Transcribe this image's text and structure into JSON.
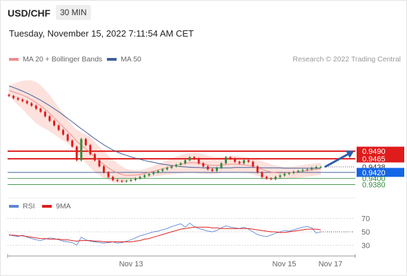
{
  "header": {
    "symbol": "USD/CHF",
    "timeframe": "30 MIN",
    "datetime": "Tuesday, November 15, 2022 7:11:54 AM CET",
    "credit": "Research © 2022 Trading Central"
  },
  "legend": {
    "ma20_label": "MA 20 + Bollinger Bands",
    "ma50_label": "MA 50",
    "rsi_label": "RSI",
    "ma9_label": "9MA"
  },
  "colors": {
    "bull": "#2e8b3a",
    "bear": "#e01b1b",
    "ma20": "#f08c8c",
    "band_fill": "#fde1dc",
    "ma50": "#3f5f9a",
    "resistance": "#e01b1b",
    "support": "#2e8b3a",
    "price_tag": "#1565e8",
    "rsi": "#5c86d6",
    "rsi_ma": "#e01b1b",
    "arrow": "#2e5fa8"
  },
  "chart_data": [
    {
      "type": "candlestick",
      "title": "USD/CHF 30 MIN",
      "x_ticks": [
        "Nov 13",
        "Nov 15",
        "Nov 17"
      ],
      "ylim": [
        0.934,
        0.972
      ],
      "price_levels": [
        {
          "value": "0.9490",
          "kind": "resistance"
        },
        {
          "value": "0.9465",
          "kind": "resistance"
        },
        {
          "value": "0.9438",
          "kind": "last_price"
        },
        {
          "value": "0.9420",
          "kind": "current"
        },
        {
          "value": "0.9400",
          "kind": "support"
        },
        {
          "value": "0.9380",
          "kind": "support"
        }
      ],
      "closes": [
        0.9672,
        0.9665,
        0.966,
        0.9655,
        0.9648,
        0.964,
        0.963,
        0.962,
        0.9605,
        0.959,
        0.9575,
        0.956,
        0.9545,
        0.9525,
        0.9505,
        0.946,
        0.953,
        0.951,
        0.948,
        0.946,
        0.944,
        0.942,
        0.9405,
        0.9395,
        0.9392,
        0.939,
        0.9392,
        0.9395,
        0.94,
        0.9405,
        0.941,
        0.9415,
        0.942,
        0.9425,
        0.943,
        0.9435,
        0.944,
        0.9445,
        0.945,
        0.946,
        0.947,
        0.9465,
        0.945,
        0.944,
        0.943,
        0.9425,
        0.9435,
        0.945,
        0.947,
        0.9465,
        0.9455,
        0.945,
        0.946,
        0.9455,
        0.944,
        0.942,
        0.9405,
        0.94,
        0.9398,
        0.9405,
        0.941,
        0.9415,
        0.9418,
        0.9422,
        0.9425,
        0.9428,
        0.943,
        0.9435,
        0.9438,
        0.9438
      ],
      "ma20": [
        0.969,
        0.9685,
        0.968,
        0.9675,
        0.9668,
        0.966,
        0.965,
        0.964,
        0.9628,
        0.9615,
        0.96,
        0.9585,
        0.957,
        0.9555,
        0.954,
        0.9522,
        0.951,
        0.9498,
        0.9485,
        0.947,
        0.9458,
        0.9446,
        0.9435,
        0.9425,
        0.9418,
        0.9413,
        0.941,
        0.941,
        0.9411,
        0.9413,
        0.9416,
        0.942,
        0.9424,
        0.9428,
        0.9432,
        0.9436,
        0.944,
        0.9444,
        0.9447,
        0.945,
        0.9452,
        0.9452,
        0.945,
        0.9448,
        0.9445,
        0.9443,
        0.9443,
        0.9444,
        0.9446,
        0.9447,
        0.9447,
        0.9446,
        0.9445,
        0.9443,
        0.944,
        0.9435,
        0.943,
        0.9425,
        0.9421,
        0.9419,
        0.9418,
        0.9418,
        0.9419,
        0.942,
        0.9422,
        0.9424,
        0.9426,
        0.9428,
        0.943,
        0.9432
      ],
      "bb_upper": [
        0.9705,
        0.9712,
        0.9718,
        0.9722,
        0.9724,
        0.9723,
        0.9718,
        0.9708,
        0.9692,
        0.9675,
        0.9655,
        0.9635,
        0.9615,
        0.9595,
        0.9575,
        0.956,
        0.9552,
        0.9545,
        0.9535,
        0.952,
        0.9505,
        0.949,
        0.9475,
        0.9462,
        0.945,
        0.944,
        0.9432,
        0.9428,
        0.9427,
        0.9428,
        0.9431,
        0.9436,
        0.9442,
        0.9448,
        0.9454,
        0.946,
        0.9466,
        0.9472,
        0.9477,
        0.9481,
        0.9484,
        0.9485,
        0.9484,
        0.948,
        0.9476,
        0.9472,
        0.947,
        0.947,
        0.9472,
        0.9474,
        0.9474,
        0.9473,
        0.9471,
        0.9469,
        0.9466,
        0.9462,
        0.9457,
        0.9452,
        0.9447,
        0.9443,
        0.944,
        0.9439,
        0.9439,
        0.944,
        0.9442,
        0.9444,
        0.9446,
        0.9448,
        0.945,
        0.9452
      ],
      "bb_lower": [
        0.9675,
        0.9658,
        0.9642,
        0.9628,
        0.9612,
        0.9597,
        0.9582,
        0.9572,
        0.9564,
        0.9555,
        0.9545,
        0.9535,
        0.9525,
        0.9515,
        0.9505,
        0.9484,
        0.9468,
        0.9451,
        0.9435,
        0.942,
        0.9411,
        0.9402,
        0.9395,
        0.9388,
        0.9386,
        0.9386,
        0.9388,
        0.9392,
        0.9395,
        0.9398,
        0.9401,
        0.9404,
        0.9406,
        0.9408,
        0.941,
        0.9412,
        0.9414,
        0.9416,
        0.9417,
        0.9419,
        0.942,
        0.9419,
        0.9416,
        0.9416,
        0.9414,
        0.9414,
        0.9416,
        0.9418,
        0.942,
        0.942,
        0.942,
        0.9419,
        0.9419,
        0.9417,
        0.9414,
        0.9408,
        0.9403,
        0.9398,
        0.9395,
        0.9395,
        0.9396,
        0.9397,
        0.9399,
        0.94,
        0.9402,
        0.9404,
        0.9406,
        0.9408,
        0.941,
        0.9412
      ],
      "ma50": [
        0.9705,
        0.97,
        0.9694,
        0.9688,
        0.9681,
        0.9674,
        0.9666,
        0.9658,
        0.9649,
        0.964,
        0.963,
        0.962,
        0.9609,
        0.9598,
        0.9587,
        0.9575,
        0.9564,
        0.9553,
        0.9542,
        0.9531,
        0.9521,
        0.9511,
        0.9502,
        0.9494,
        0.9487,
        0.9481,
        0.9476,
        0.9471,
        0.9467,
        0.9463,
        0.9459,
        0.9456,
        0.9453,
        0.945,
        0.9447,
        0.9445,
        0.9443,
        0.9441,
        0.9439,
        0.9438,
        0.9437,
        0.9436,
        0.9436,
        0.9435,
        0.9435,
        0.9435,
        0.9435,
        0.9435,
        0.9435,
        0.9435,
        0.9436,
        0.9436,
        0.9436,
        0.9436,
        0.9436,
        0.9436,
        0.9435,
        0.9435,
        0.9435,
        0.9435,
        0.9435,
        0.9434,
        0.9434,
        0.9434,
        0.9434,
        0.9434,
        0.9434,
        0.9434,
        0.9434,
        0.9434
      ],
      "forecast": {
        "from": 0.9438,
        "to": 0.949
      }
    },
    {
      "type": "line",
      "title": "RSI",
      "ylim": [
        20,
        80
      ],
      "y_ticks": [
        "70",
        "50",
        "30"
      ],
      "series": [
        {
          "name": "RSI",
          "values": [
            46,
            44,
            43,
            45,
            42,
            40,
            38,
            37,
            39,
            41,
            40,
            38,
            36,
            35,
            34,
            30,
            42,
            38,
            36,
            35,
            34,
            33,
            34,
            35,
            33,
            34,
            36,
            38,
            41,
            44,
            46,
            48,
            50,
            51,
            53,
            55,
            58,
            60,
            62,
            57,
            63,
            58,
            55,
            53,
            51,
            50,
            52,
            56,
            59,
            57,
            56,
            55,
            57,
            54,
            50,
            46,
            44,
            43,
            45,
            48,
            50,
            52,
            51,
            53,
            55,
            57,
            58,
            56,
            48,
            50
          ]
        },
        {
          "name": "9MA",
          "values": [
            45,
            45,
            44,
            44,
            43,
            42,
            41,
            40,
            40,
            39,
            39,
            39,
            38,
            38,
            37,
            36,
            37,
            37,
            37,
            36,
            36,
            35,
            35,
            35,
            35,
            35,
            35,
            35,
            36,
            37,
            39,
            40,
            42,
            44,
            46,
            48,
            50,
            52,
            54,
            55,
            56,
            57,
            57,
            57,
            57,
            56,
            56,
            55,
            55,
            55,
            55,
            55,
            55,
            55,
            54,
            53,
            52,
            51,
            50,
            50,
            49,
            49,
            50,
            51,
            52,
            53,
            54,
            54,
            54,
            53
          ]
        }
      ]
    }
  ]
}
